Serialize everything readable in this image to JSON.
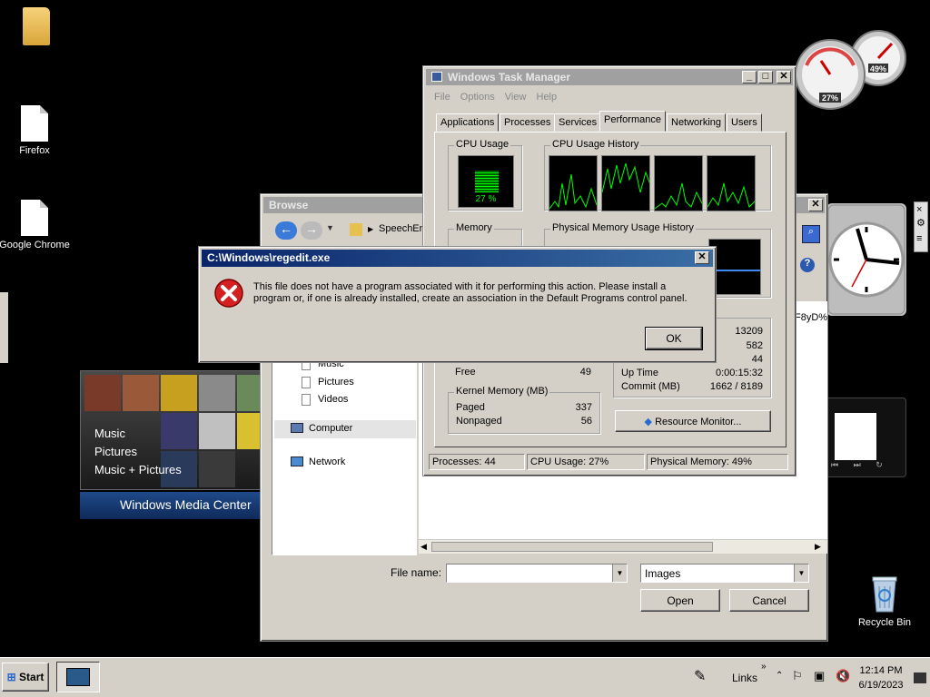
{
  "desktop": {
    "icons": [
      {
        "label": ""
      },
      {
        "label": "Firefox"
      },
      {
        "label": "Google Chrome"
      },
      {
        "label": "Recycle Bin"
      }
    ]
  },
  "gadgets": {
    "cpu_meter": {
      "cpu_value": "27%",
      "memory_value": "49%"
    },
    "media_center": {
      "items": [
        "Music",
        "Pictures",
        "Music + Pictures"
      ],
      "brand": "Windows Media Center"
    }
  },
  "browse_dialog": {
    "title": "Browse",
    "breadcrumb": "SpeechEngi",
    "nav_items": [
      {
        "label": "Music"
      },
      {
        "label": "Pictures"
      },
      {
        "label": "Videos"
      },
      {
        "label": "Computer"
      },
      {
        "label": "Network"
      }
    ],
    "partial_text_right": "F8yD%",
    "partial_text_e": "e",
    "filename_label": "File name:",
    "filename_value": "",
    "filetype_value": "Images",
    "open_label": "Open",
    "cancel_label": "Cancel"
  },
  "task_manager": {
    "title": "Windows Task Manager",
    "menu": [
      "File",
      "Options",
      "View",
      "Help"
    ],
    "tabs": [
      "Applications",
      "Processes",
      "Services",
      "Performance",
      "Networking",
      "Users"
    ],
    "active_tab": "Performance",
    "cpu_usage_label": "CPU Usage",
    "cpu_usage_value": "27 %",
    "cpu_usage_fraction": 0.27,
    "cpu_history_label": "CPU Usage History",
    "memory_label": "Memory",
    "memory_history_label": "Physical Memory Usage History",
    "system_values": [
      "13209",
      "582",
      "44"
    ],
    "up_time_label": "Up Time",
    "up_time_value": "0:00:15:32",
    "commit_label": "Commit (MB)",
    "commit_value": "1662 / 8189",
    "free_label": "Free",
    "free_value": "49",
    "kernel_memory_label": "Kernel Memory (MB)",
    "paged_label": "Paged",
    "paged_value": "337",
    "nonpaged_label": "Nonpaged",
    "nonpaged_value": "56",
    "resource_monitor_label": "Resource Monitor...",
    "status": {
      "processes": "Processes: 44",
      "cpu": "CPU Usage: 27%",
      "memory": "Physical Memory: 49%"
    }
  },
  "error_dialog": {
    "title": "C:\\Windows\\regedit.exe",
    "message": "This file does not have a program associated with it for performing this action. Please install a program or, if one is already installed, create an association in the Default Programs control panel.",
    "ok_label": "OK"
  },
  "taskbar": {
    "start_label": "Start",
    "links_label": "Links",
    "time": "12:14 PM",
    "date": "6/19/2023"
  }
}
